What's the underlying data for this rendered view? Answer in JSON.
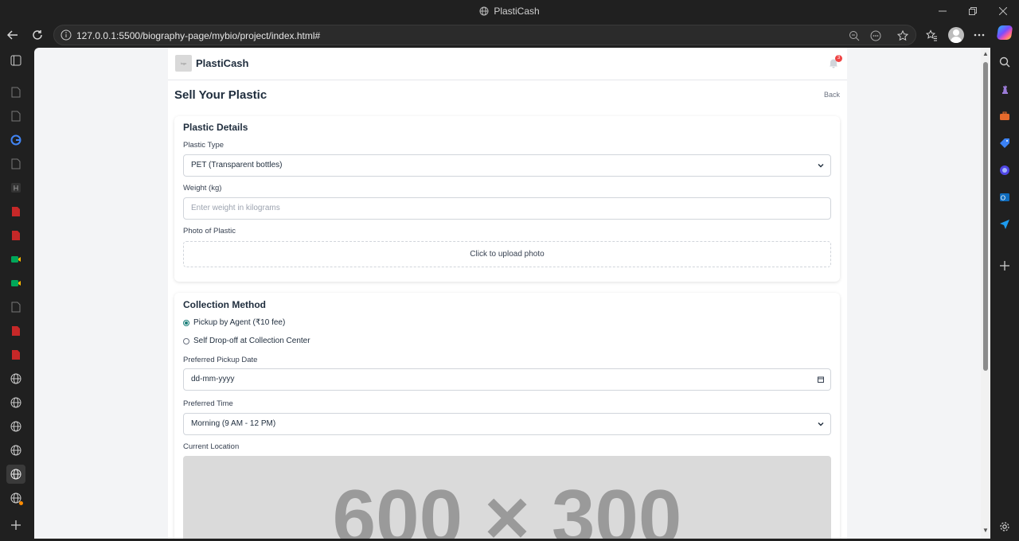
{
  "window": {
    "title": "PlastiCash"
  },
  "browser": {
    "url": "127.0.0.1:5500/biography-page/mybio/project/index.html#"
  },
  "app": {
    "brand": "PlastiCash",
    "notification_count": "3",
    "page_title": "Sell Your Plastic",
    "back_label": "Back",
    "plastic_details": {
      "heading": "Plastic Details",
      "type_label": "Plastic Type",
      "type_value": "PET (Transparent bottles)",
      "weight_label": "Weight (kg)",
      "weight_placeholder": "Enter weight in kilograms",
      "photo_label": "Photo of Plastic",
      "upload_text": "Click to upload photo"
    },
    "collection": {
      "heading": "Collection Method",
      "option_pickup": "Pickup by Agent (₹10 fee)",
      "option_dropoff": "Self Drop-off at Collection Center",
      "date_label": "Preferred Pickup Date",
      "date_placeholder": "dd-mm-yyyy",
      "time_label": "Preferred Time",
      "time_value": "Morning (9 AM - 12 PM)",
      "location_label": "Current Location",
      "map_placeholder": "600 × 300"
    }
  },
  "colors": {
    "accent": "#1b7f79",
    "badge": "#ef4444",
    "text": "#1f2d3d"
  }
}
